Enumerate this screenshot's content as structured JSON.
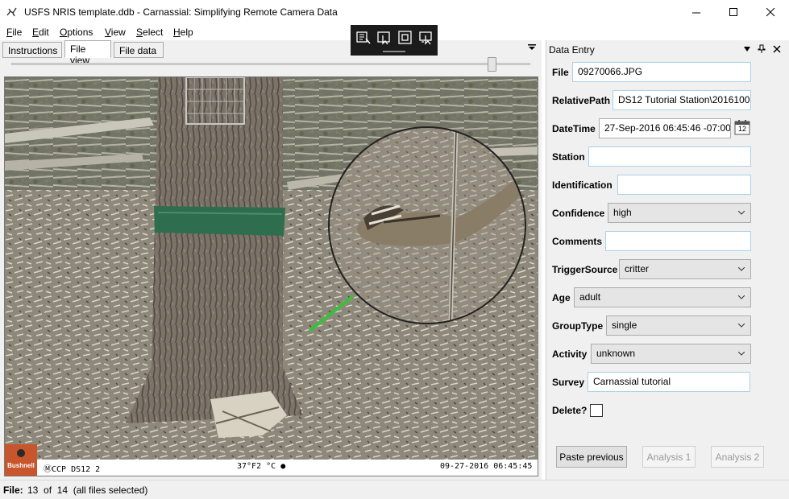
{
  "window": {
    "title": "USFS NRIS template.ddb - Carnassial: Simplifying Remote Camera Data",
    "icon": "bird-logo-icon"
  },
  "menu": [
    {
      "label": "File",
      "accel": "F"
    },
    {
      "label": "Edit",
      "accel": "E"
    },
    {
      "label": "Options",
      "accel": "O"
    },
    {
      "label": "View",
      "accel": "V"
    },
    {
      "label": "Select",
      "accel": "S"
    },
    {
      "label": "Help",
      "accel": "H"
    }
  ],
  "tabs": [
    {
      "label": "Instructions",
      "active": false
    },
    {
      "label": "File view",
      "active": true
    },
    {
      "label": "File data",
      "active": false
    }
  ],
  "image_slider": {
    "position": 0.925
  },
  "camera_overlay": {
    "brand": "Bushnell",
    "id": "CCP DS12 2",
    "temp": "37°F2 °C",
    "datetime": "09-27-2016 06:45:45"
  },
  "data_entry": {
    "title": "Data Entry",
    "fields": {
      "file": {
        "label": "File",
        "value": "09270066.JPG"
      },
      "relative_path": {
        "label": "RelativePath",
        "value": "DS12 Tutorial Station\\2016100"
      },
      "date_time": {
        "label": "DateTime",
        "value": "27-Sep-2016 06:45:46 -07:00"
      },
      "station": {
        "label": "Station",
        "value": ""
      },
      "identification": {
        "label": "Identification",
        "value": ""
      },
      "confidence": {
        "label": "Confidence",
        "value": "high"
      },
      "comments": {
        "label": "Comments",
        "value": ""
      },
      "trigger_source": {
        "label": "TriggerSource",
        "value": "critter"
      },
      "age": {
        "label": "Age",
        "value": "adult"
      },
      "group_type": {
        "label": "GroupType",
        "value": "single"
      },
      "activity": {
        "label": "Activity",
        "value": "unknown"
      },
      "survey": {
        "label": "Survey",
        "value": "Carnassial tutorial"
      },
      "delete": {
        "label": "Delete?",
        "checked": false
      }
    },
    "calendar_day": "12",
    "buttons": {
      "paste_previous": "Paste previous",
      "analysis_1": "Analysis 1",
      "analysis_2": "Analysis 2"
    }
  },
  "status": {
    "label": "File:",
    "text": "13  of  14  (all files selected)"
  },
  "colors": {
    "accent_border": "#a9d1e9",
    "toolbar_bg": "#1b1b1b",
    "band_green": "#2e6e4f"
  }
}
